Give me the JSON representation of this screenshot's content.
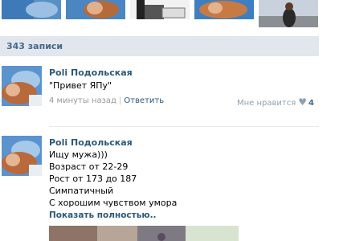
{
  "wall": {
    "count_label": "343 записи"
  },
  "posts": [
    {
      "author": "Poli Подольская",
      "text": "\"Привет ЯПу\"",
      "time": "4 минуты назад",
      "separator": "|",
      "reply_label": "Ответить",
      "like_label": "Мне нравится",
      "like_icon": "heart-icon",
      "like_count": "4"
    },
    {
      "author": "Poli Подольская",
      "text_lines": [
        "Ищу мужа)))",
        "Возраст от 22-29",
        "Рост от 173 до 187",
        "Симпатичный",
        "С хорошим чувством умора"
      ],
      "show_more_label": "Показать полностью.."
    }
  ],
  "colors": {
    "link": "#2b587a",
    "count_bar_bg": "#e1e7ed",
    "meta_gray": "#999999"
  }
}
